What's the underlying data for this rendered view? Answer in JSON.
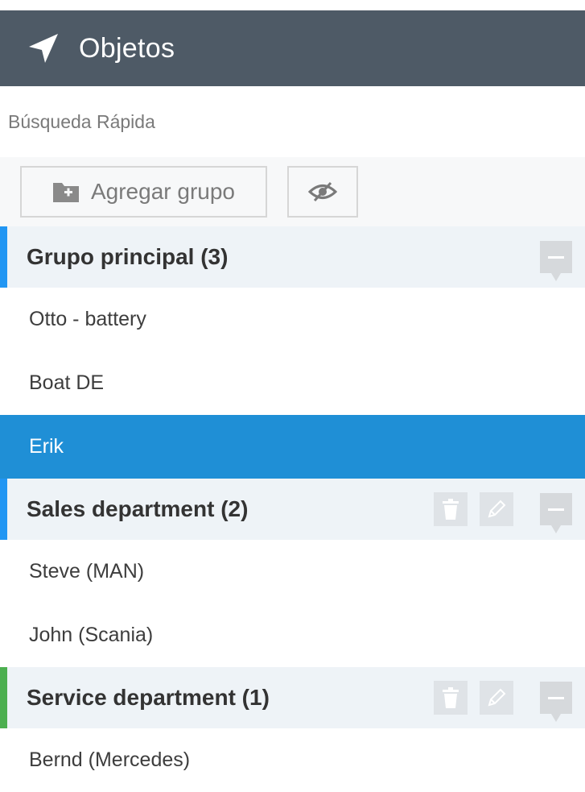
{
  "header": {
    "title": "Objetos",
    "icon": "navigation-arrow-icon"
  },
  "search": {
    "placeholder": "Búsqueda Rápida"
  },
  "toolbar": {
    "add_group_label": "Agregar grupo",
    "toggle_visibility_icon": "eye-slash-icon"
  },
  "colors": {
    "header_bg": "#4e5a66",
    "selected_bg": "#1f8fd6",
    "group_bar_blue": "#2196f3",
    "group_bar_green": "#4caf50"
  },
  "groups": [
    {
      "name": "Grupo principal (3)",
      "color": "#2196f3",
      "items": [
        "Otto - battery",
        "Boat DE",
        "Erik"
      ],
      "selected_item": "Erik"
    },
    {
      "name": "Sales department (2)",
      "color": "#2196f3",
      "items": [
        "Steve (MAN)",
        "John (Scania)"
      ]
    },
    {
      "name": "Service department (1)",
      "color": "#4caf50",
      "items": [
        "Bernd (Mercedes)"
      ]
    }
  ]
}
